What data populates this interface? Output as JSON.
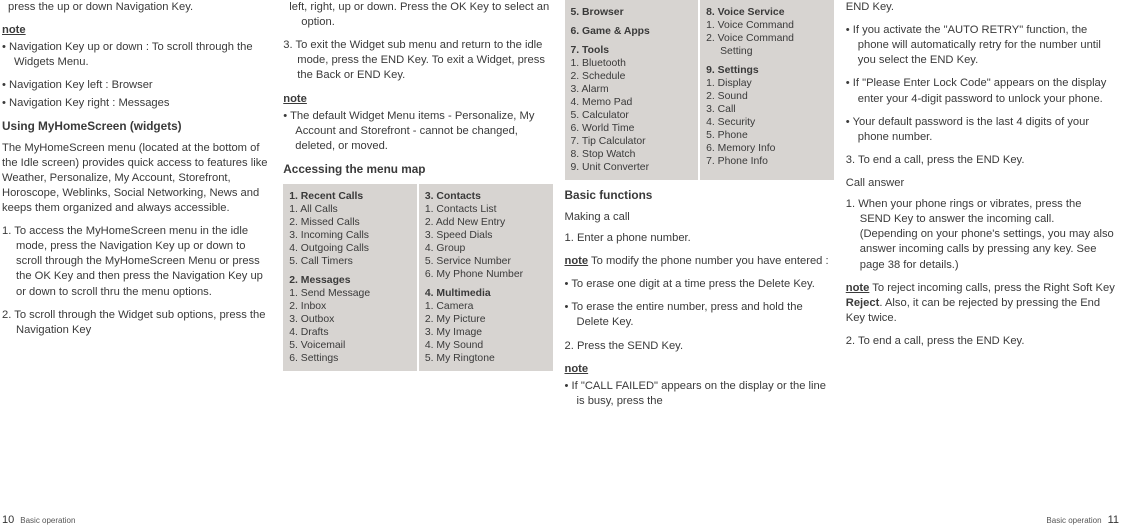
{
  "col1": {
    "p1": "press the up or down Navigation Key.",
    "noteLabel": "note",
    "b1": "• Navigation Key up or down : To scroll through the Widgets Menu.",
    "b2": "• Navigation Key left : Browser",
    "b3": "• Navigation Key right : Messages",
    "h1": "Using MyHomeScreen (widgets)",
    "p2": "The MyHomeScreen menu (located at the bottom of the Idle screen) provides quick access to features like Weather, Personalize, My Account, Storefront, Horoscope, Weblinks, Social Networking, News and keeps them organized and always accessible.",
    "n1": "1. To access the MyHomeScreen menu in the idle mode, press the Navigation Key up or down to scroll through the MyHomeScreen Menu or press the OK Key and then press the Navigation Key up or down to scroll thru the menu options.",
    "n2": "2. To scroll through the Widget sub options, press the Navigation Key"
  },
  "col2": {
    "p1": "left, right, up or down. Press the OK Key to select an option.",
    "n3": "3. To exit the Widget sub menu and return to the idle mode, press the END Key. To exit a Widget, press the Back or END Key.",
    "noteLabel": "note",
    "noteText": "• The default Widget Menu items - Personalize, My Account and Storefront - cannot be changed, deleted, or moved.",
    "h2": "Accessing the menu map",
    "menuA": {
      "g1t": "1. Recent Calls",
      "g1": [
        "1.  All Calls",
        "2. Missed Calls",
        "3. Incoming Calls",
        "4. Outgoing Calls",
        "5. Call Timers"
      ],
      "g2t": "2. Messages",
      "g2": [
        "1.  Send Message",
        "2. Inbox",
        "3. Outbox",
        "4. Drafts",
        "5. Voicemail",
        "6. Settings"
      ]
    },
    "menuB": {
      "g3t": "3. Contacts",
      "g3": [
        "1.  Contacts List",
        "2. Add New Entry",
        "3. Speed Dials",
        "4. Group",
        "5. Service Number",
        "6. My Phone Number"
      ],
      "g4t": "4. Multimedia",
      "g4": [
        "1.  Camera",
        "2. My Picture",
        "3. My Image",
        "4. My Sound",
        "5. My Ringtone"
      ]
    }
  },
  "col3": {
    "menuC": {
      "g5t": "5. Browser",
      "g6t": "6. Game & Apps",
      "g7t": "7. Tools",
      "g7": [
        "1.  Bluetooth",
        "2. Schedule",
        "3. Alarm",
        "4. Memo Pad",
        "5. Calculator",
        "6. World Time",
        "7.  Tip Calculator",
        "8. Stop Watch",
        "9. Unit Converter"
      ]
    },
    "menuD": {
      "g8t": "8. Voice Service",
      "g8": [
        "1.  Voice Command",
        "2. Voice  Command Setting"
      ],
      "g9t": "9. Settings",
      "g9": [
        "1.  Display",
        "2. Sound",
        "3. Call",
        "4. Security",
        "5. Phone",
        "6. Memory Info",
        "7.  Phone Info"
      ]
    },
    "h3": "Basic functions",
    "sub1": "Making a call",
    "s1": "1. Enter a phone number.",
    "noteLabel": "note",
    "noteText1": " To modify the phone number you have entered :",
    "b1": "• To erase one digit at a time press the Delete Key.",
    "b2": "• To erase the entire number, press and hold the Delete Key.",
    "s2": "2. Press the SEND Key.",
    "noteLabel2": "note",
    "b3": "• If \"CALL FAILED\" appears on the display or the line is busy, press the"
  },
  "col4": {
    "p1": "END Key.",
    "b1": "• If you activate the \"AUTO RETRY\" function, the phone will automatically retry for the number until you select the END Key.",
    "b2": "• If \"Please Enter Lock Code\" appears on the display enter your 4-digit password to unlock your phone.",
    "b3": "• Your default password is the last 4 digits of your phone number.",
    "s3": "3. To end a call, press the END Key.",
    "sub2": "Call answer",
    "s4": "1. When your phone rings or vibrates, press the SEND Key to answer the incoming call. (Depending on your phone's settings, you may also answer incoming calls by pressing any key. See page 38 for details.)",
    "noteLabel": "note",
    "noteText_a": " To reject incoming calls, press the Right Soft Key ",
    "noteText_reject": "Reject",
    "noteText_b": ". Also, it can be rejected by pressing the End Key twice.",
    "s5": "2. To end a call, press the END Key."
  },
  "footer": {
    "leftNum": "10",
    "leftLabel": "Basic operation",
    "rightLabel": "Basic operation",
    "rightNum": "11"
  }
}
